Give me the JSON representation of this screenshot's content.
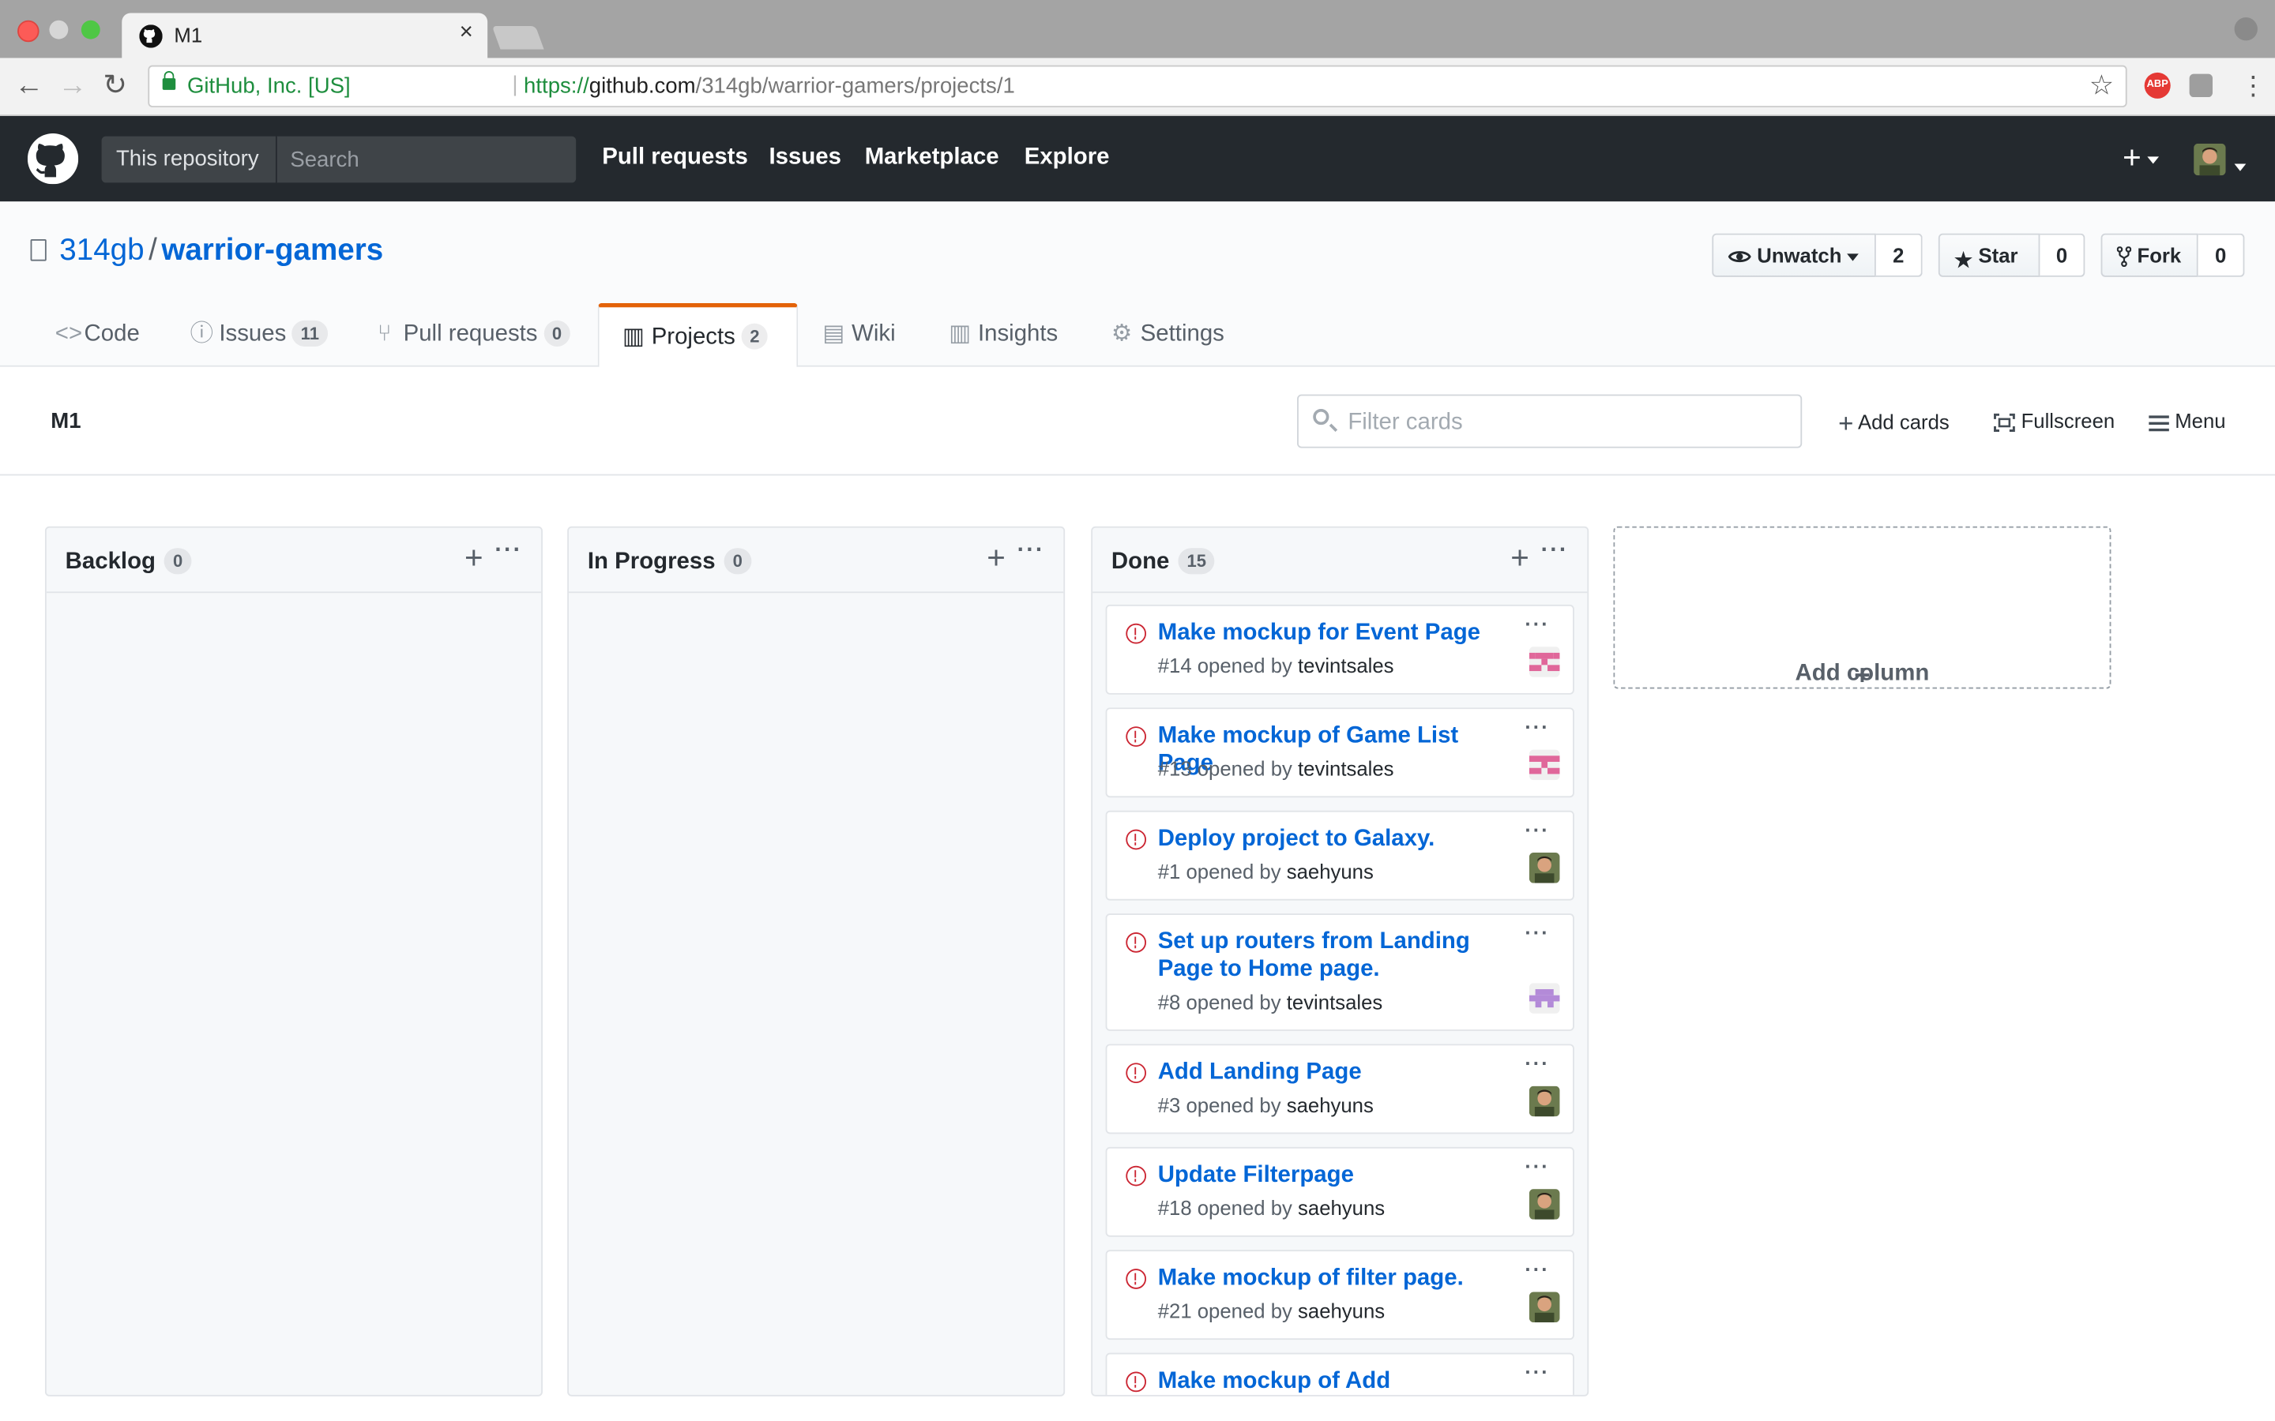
{
  "browser": {
    "tab_title": "M1",
    "tab_close": "×",
    "secure_label": "GitHub, Inc. [US]",
    "url_scheme": "https://",
    "url_host": "github.com",
    "url_path": "/314gb/warrior-gamers/projects/1",
    "back_glyph": "←",
    "forward_glyph": "→",
    "reload_glyph": "↻",
    "star_glyph": "☆",
    "abp_label": "ABP",
    "kebab_glyph": "⋮"
  },
  "header": {
    "scope_label": "This repository",
    "search_placeholder": "Search",
    "nav": [
      "Pull requests",
      "Issues",
      "Marketplace",
      "Explore"
    ],
    "plus_glyph": "+"
  },
  "repo": {
    "owner": "314gb",
    "separator": "/",
    "name": "warrior-gamers",
    "unwatch_label": "Unwatch",
    "unwatch_count": "2",
    "star_label": "Star",
    "star_count": "0",
    "fork_label": "Fork",
    "fork_count": "0",
    "tabs": [
      {
        "label": "Code",
        "icon": "<>",
        "count": ""
      },
      {
        "label": "Issues",
        "icon": "ⓘ",
        "count": "11"
      },
      {
        "label": "Pull requests",
        "icon": "⑂",
        "count": "0"
      },
      {
        "label": "Projects",
        "icon": "▥",
        "count": "2"
      },
      {
        "label": "Wiki",
        "icon": "▤",
        "count": ""
      },
      {
        "label": "Insights",
        "icon": "▥",
        "count": ""
      },
      {
        "label": "Settings",
        "icon": "⚙",
        "count": ""
      }
    ]
  },
  "project": {
    "name": "M1",
    "filter_placeholder": "Filter cards",
    "add_cards_label": "Add cards",
    "fullscreen_label": "Fullscreen",
    "menu_label": "Menu"
  },
  "columns": [
    {
      "name": "Backlog",
      "count": "0"
    },
    {
      "name": "In Progress",
      "count": "0"
    },
    {
      "name": "Done",
      "count": "15"
    }
  ],
  "column_add_glyph": "+",
  "more_glyph": "···",
  "cards": [
    {
      "title": "Make mockup for Event Page",
      "number": "#14",
      "opened_by": "opened by",
      "author": "tevintsales",
      "avatar": "identicon-pink"
    },
    {
      "title": "Make mockup of Game List Page",
      "number": "#13",
      "opened_by": "opened by",
      "author": "tevintsales",
      "avatar": "identicon-pink"
    },
    {
      "title": "Deploy project to Galaxy.",
      "number": "#1",
      "opened_by": "opened by",
      "author": "saehyuns",
      "avatar": "photo"
    },
    {
      "title": "Set up routers from Landing Page to Home page.",
      "number": "#8",
      "opened_by": "opened by",
      "author": "tevintsales",
      "avatar": "identicon-purple"
    },
    {
      "title": "Add Landing Page",
      "number": "#3",
      "opened_by": "opened by",
      "author": "saehyuns",
      "avatar": "photo"
    },
    {
      "title": "Update Filterpage",
      "number": "#18",
      "opened_by": "opened by",
      "author": "saehyuns",
      "avatar": "photo"
    },
    {
      "title": "Make mockup of filter page.",
      "number": "#21",
      "opened_by": "opened by",
      "author": "saehyuns",
      "avatar": "photo"
    },
    {
      "title": "Make mockup of Add",
      "number": "",
      "opened_by": "",
      "author": "",
      "avatar": ""
    }
  ],
  "add_column_label": "Add column",
  "colors": {
    "accent_link": "#0366d6",
    "issue_open": "#cb2431",
    "selected_tab_border": "#e36209",
    "header_bg": "#24292e"
  }
}
